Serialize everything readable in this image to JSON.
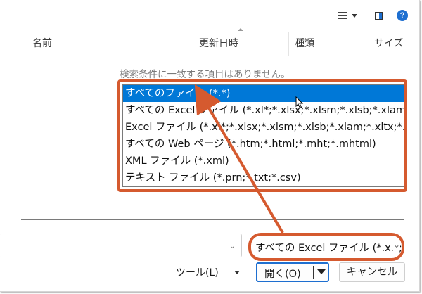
{
  "columns": {
    "name": "名前",
    "modified": "更新日時",
    "type": "種類",
    "size": "サイズ"
  },
  "empty_message": "検索条件に一致する項目はありません。",
  "file_types": [
    {
      "label": "すべてのファイル (*.*)",
      "selected": true
    },
    {
      "label": "すべての Excel ファイル (*.xl*;*.xlsx;*.xlsm;*.xlsb;*.xlam;*.xltx;*.xltm;*.xls;*.xla;*.xlt;*.xlm;*.xlw)"
    },
    {
      "label": "Excel ファイル (*.xl*;*.xlsx;*.xlsm;*.xlsb;*.xlam;*.xltx;*.xltm;*.xls;*.xla;*.xlt;*.xlm;*.xlw)"
    },
    {
      "label": "すべての Web ページ (*.htm;*.html;*.mht;*.mhtml)"
    },
    {
      "label": "XML ファイル (*.xml)"
    },
    {
      "label": "テキスト ファイル (*.prn;*.txt;*.csv)"
    }
  ],
  "filetype_select": {
    "value": "すべての Excel ファイル (*.xl*;*.xlsx;*.xlsm;*.xlsb;*.xlam;*.xltx;*.xltm;*.xls;*.xla;*.xlt;*.xlm;*.xlw)"
  },
  "buttons": {
    "tools": "ツール(L)",
    "open": "開く(O)",
    "cancel": "キャンセル"
  },
  "toolbar": {
    "help": "?"
  },
  "icons": {
    "view": "view-options-icon",
    "pane": "preview-pane-icon",
    "help": "help-icon",
    "cursor": "mouse-pointer-icon"
  },
  "colors": {
    "selection": "#0078d7",
    "annotation": "#d55a2f",
    "accent": "#1e6fd0"
  }
}
